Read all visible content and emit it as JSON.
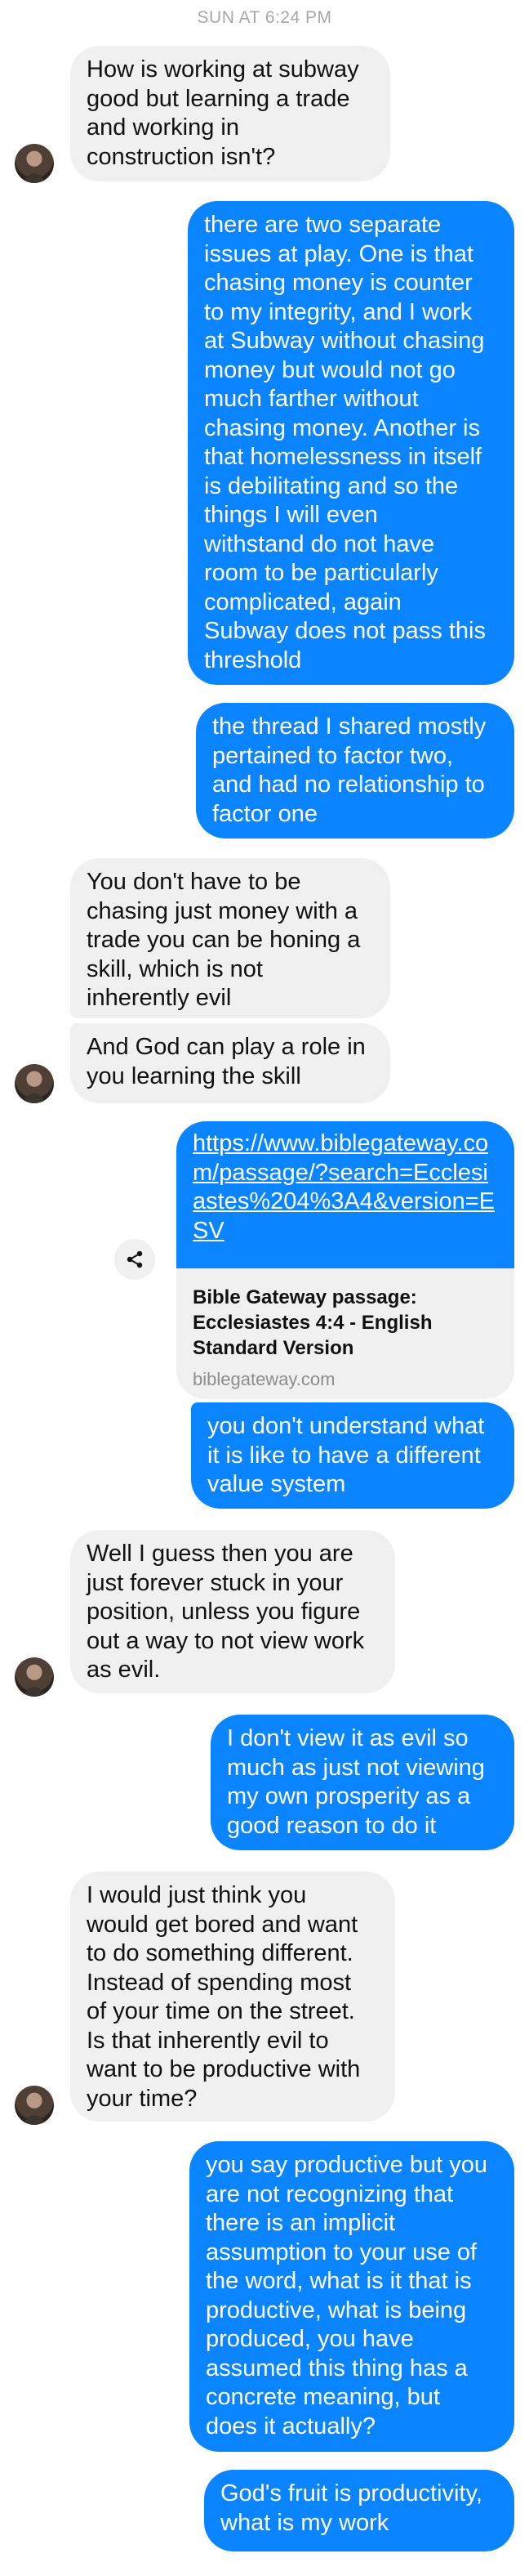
{
  "timestamp": "SUN AT 6:24 PM",
  "messages": {
    "m1": "How is working at subway\ngood but learning a trade\nand working in\nconstruction isn't?",
    "m2": "there are two separate\nissues at play. One is that\nchasing money is counter\nto my integrity, and I work\nat Subway without chasing\nmoney but would not go\nmuch farther without\nchasing money. Another is\nthat homelessness in itself\nis debilitating and so the\nthings I will even\nwithstand do not have\nroom to be particularly\ncomplicated, again\nSubway does not pass this\nthreshold",
    "m3": "the thread I shared mostly\npertained to factor two,\nand had no relationship to\nfactor one",
    "m4": "You don't have to be\nchasing just money with a\ntrade you can be honing a\nskill, which is not\ninherently evil",
    "m5": "And God can play a role in\nyou learning the skill",
    "m6_link": {
      "url": "https://www.biblegateway.com/passage/?search=Ecclesiastes%204%3A4&version=ESV",
      "title": "Bible Gateway passage: Ecclesiastes 4:4 - English Standard Version",
      "domain": "biblegateway.com"
    },
    "m7": "you don't understand what\nit is like to have a different\nvalue system",
    "m8": "Well I guess then you are\njust forever stuck in your\nposition, unless you figure\nout a way to not view work\nas evil.",
    "m9": "I don't view it as evil so\nmuch as just not viewing\nmy own prosperity as a\ngood reason to do it",
    "m10": "I would just think you\nwould get bored and want\nto do something different.\nInstead of spending most\nof your time on the street.\nIs that inherently evil to\nwant to be productive with\nyour time?",
    "m11": "you say productive but you\nare not recognizing that\nthere is an implicit\nassumption to your use of\nthe word, what is it that is\nproductive, what is being\nproduced, you have\nassumed this thing has a\nconcrete meaning, but\ndoes it actually?",
    "m12": "God's fruit is productivity,\nwhat is my work"
  },
  "icons": {
    "share": "share-icon",
    "avatar": "contact-avatar"
  },
  "colors": {
    "outgoing": "#0a84ff",
    "incoming": "#f1f0f0",
    "timestamp": "#a7a7a7"
  }
}
